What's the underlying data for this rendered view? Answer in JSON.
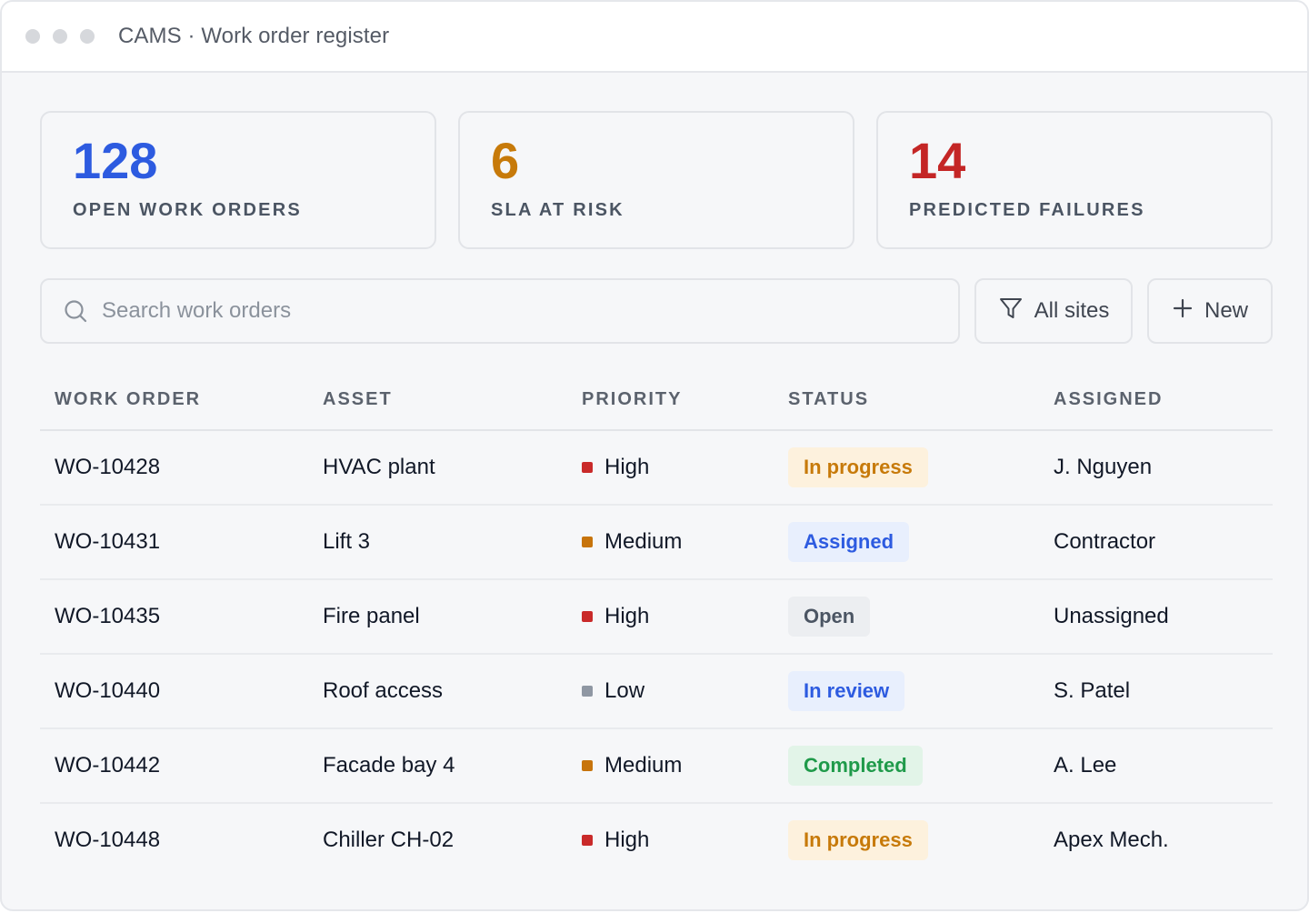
{
  "window": {
    "title": "CAMS · Work order register"
  },
  "stats": [
    {
      "value": "128",
      "label": "OPEN WORK ORDERS",
      "color": "#2d5be0"
    },
    {
      "value": "6",
      "label": "SLA AT RISK",
      "color": "#c77a0a"
    },
    {
      "value": "14",
      "label": "PREDICTED FAILURES",
      "color": "#c42626"
    }
  ],
  "toolbar": {
    "search_placeholder": "Search work orders",
    "search_value": "",
    "filter_label": "All sites",
    "new_label": "New",
    "search_icon": "search-icon",
    "filter_icon": "filter-icon",
    "new_icon": "plus-icon"
  },
  "table": {
    "headers": [
      "WORK ORDER",
      "ASSET",
      "PRIORITY",
      "STATUS",
      "ASSIGNED"
    ],
    "rows": [
      {
        "id": "WO-10428",
        "asset": "HVAC plant",
        "priority": "High",
        "status": "In progress",
        "assigned": "J. Nguyen"
      },
      {
        "id": "WO-10431",
        "asset": "Lift 3",
        "priority": "Medium",
        "status": "Assigned",
        "assigned": "Contractor"
      },
      {
        "id": "WO-10435",
        "asset": "Fire panel",
        "priority": "High",
        "status": "Open",
        "assigned": "Unassigned"
      },
      {
        "id": "WO-10440",
        "asset": "Roof access",
        "priority": "Low",
        "status": "In review",
        "assigned": "S. Patel"
      },
      {
        "id": "WO-10442",
        "asset": "Facade bay 4",
        "priority": "Medium",
        "status": "Completed",
        "assigned": "A. Lee"
      },
      {
        "id": "WO-10448",
        "asset": "Chiller CH-02",
        "priority": "High",
        "status": "In progress",
        "assigned": "Apex Mech."
      }
    ]
  },
  "colors": {
    "priority": {
      "High": "#c92a2a",
      "Medium": "#c7740c",
      "Low": "#8f97a3"
    },
    "status": {
      "In progress": {
        "bg": "#fdf1dd",
        "fg": "#c77a0a"
      },
      "Assigned": {
        "bg": "#e8effd",
        "fg": "#2d5be0"
      },
      "Open": {
        "bg": "#eceef1",
        "fg": "#4b5563"
      },
      "In review": {
        "bg": "#e8effd",
        "fg": "#2d5be0"
      },
      "Completed": {
        "bg": "#e2f4e8",
        "fg": "#1f9a4a"
      }
    }
  }
}
